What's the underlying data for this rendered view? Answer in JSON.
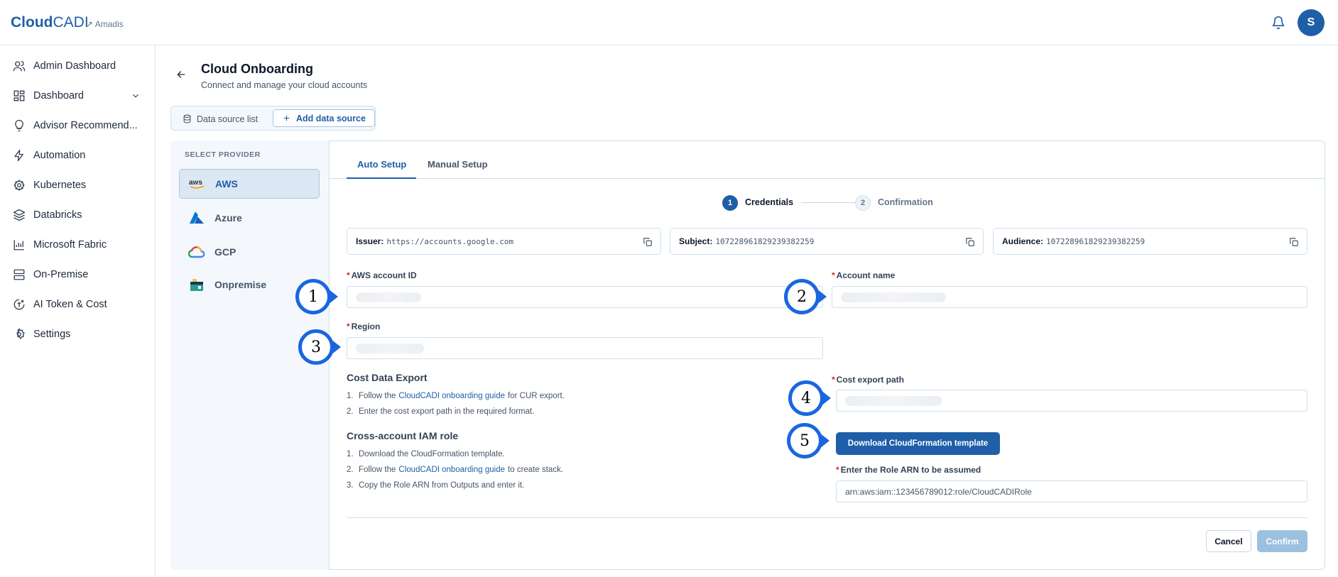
{
  "app": {
    "logo_bold": "Cloud",
    "logo_thin": "CADI",
    "org": "↗ Amadis",
    "avatar_initial": "S"
  },
  "sidebar": {
    "items": [
      {
        "label": "Admin Dashboard",
        "icon": "users-icon"
      },
      {
        "label": "Dashboard",
        "icon": "grid-icon"
      },
      {
        "label": "Advisor Recommend...",
        "icon": "lightbulb-icon"
      },
      {
        "label": "Automation",
        "icon": "bolt-icon"
      },
      {
        "label": "Kubernetes",
        "icon": "helm-icon"
      },
      {
        "label": "Databricks",
        "icon": "layers-icon"
      },
      {
        "label": "Microsoft Fabric",
        "icon": "bar-chart-icon"
      },
      {
        "label": "On-Premise",
        "icon": "server-icon"
      },
      {
        "label": "AI Token & Cost",
        "icon": "ai-token-icon"
      },
      {
        "label": "Settings",
        "icon": "gear-icon"
      }
    ]
  },
  "header": {
    "title": "Cloud Onboarding",
    "subtitle": "Connect and manage your cloud accounts"
  },
  "segment": {
    "list_label": "Data source list",
    "add_label": "Add data source"
  },
  "providers": {
    "heading": "SELECT PROVIDER",
    "items": [
      {
        "label": "AWS",
        "active": true
      },
      {
        "label": "Azure"
      },
      {
        "label": "GCP"
      },
      {
        "label": "Onpremise"
      }
    ]
  },
  "tabs": {
    "auto": "Auto Setup",
    "manual": "Manual Setup"
  },
  "steps": [
    {
      "num": "1",
      "label": "Credentials"
    },
    {
      "num": "2",
      "label": "Confirmation"
    }
  ],
  "identity": {
    "issuer_key": "Issuer:",
    "issuer_val": "https://accounts.google.com",
    "subject_key": "Subject:",
    "subject_val": "107228961829239382259",
    "audience_key": "Audience:",
    "audience_val": "107228961829239382259"
  },
  "form": {
    "aws_account_id": "AWS account ID",
    "account_name": "Account name",
    "region": "Region",
    "cost_export_path": "Cost export path",
    "role_arn_label": "Enter the Role ARN to be assumed",
    "role_arn_placeholder": "arn:aws:iam::123456789012:role/CloudCADIRole",
    "required_mark": "*"
  },
  "cost_export": {
    "title": "Cost Data Export",
    "items": [
      {
        "n": "1.",
        "pre": "Follow the",
        "link": "CloudCADI onboarding guide",
        "post": "for CUR export."
      },
      {
        "n": "2.",
        "text": "Enter the cost export path in the required format."
      }
    ]
  },
  "iam": {
    "title": "Cross-account IAM role",
    "items": [
      {
        "n": "1.",
        "text": "Download the CloudFormation template."
      },
      {
        "n": "2.",
        "pre": "Follow the",
        "link": "CloudCADI onboarding guide",
        "post": "to create stack."
      },
      {
        "n": "3.",
        "text": "Copy the Role ARN from Outputs and enter it."
      }
    ]
  },
  "download_label": "Download CloudFormation template",
  "actions": {
    "cancel": "Cancel",
    "confirm": "Confirm"
  },
  "markers": [
    "1",
    "2",
    "3",
    "4",
    "5"
  ],
  "colors": {
    "brand": "#1f5fa8",
    "marker": "#1a66e0",
    "required": "#dc2626",
    "confirm_disabled": "#9bc0e0"
  }
}
